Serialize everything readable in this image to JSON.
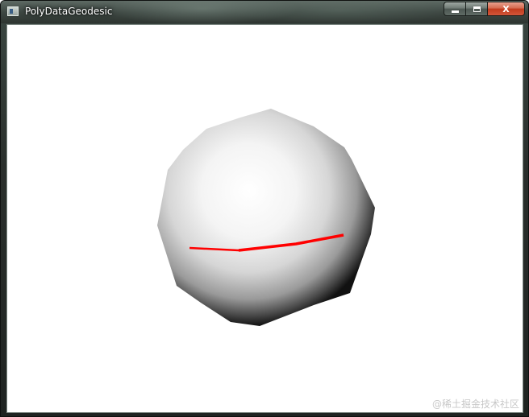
{
  "window": {
    "title": "PolyDataGeodesic",
    "icon": "vtk-window-icon",
    "controls": {
      "minimize_icon": "minimize-icon",
      "maximize_icon": "maximize-icon",
      "close_label": "X"
    }
  },
  "scene": {
    "background_color": "#ffffff",
    "sphere_color": "#ffffff",
    "geodesic_path_color": "#ff0000"
  },
  "watermark": "@稀土掘金技术社区"
}
